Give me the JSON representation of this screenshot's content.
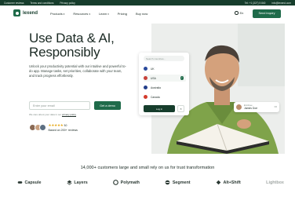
{
  "topbar": {
    "left_links": [
      "Customer reviews",
      "Terms and conditions",
      "Privacy policy"
    ],
    "phone": "Tel: +1 (327) 5 840",
    "email": "info@lexend.com"
  },
  "nav": {
    "logo_text": "lexend",
    "menu": [
      {
        "label": "Products",
        "has_dropdown": true
      },
      {
        "label": "Resources",
        "has_dropdown": true
      },
      {
        "label": "Learn",
        "has_dropdown": true
      },
      {
        "label": "Pricing",
        "has_dropdown": false
      },
      {
        "label": "Buy now",
        "has_dropdown": false
      }
    ],
    "language": "En",
    "cta_label": "Send inquiry"
  },
  "hero": {
    "title_line1": "Use Data & AI,",
    "title_line2": "Responsibly",
    "subtitle": "Unlock your productivity potential with our intuitive and powerful to-do app. Manage tasks, set priorities, collaborate with your team, and track progress effortlessly.",
    "email_placeholder": "Enter your email",
    "demo_button": "Get a demo",
    "privacy_text": "We care about your data in our",
    "privacy_link": "privacy policy",
    "rating_score": "5.0",
    "reviews": "Based on 200+ reviews"
  },
  "country_card": {
    "search_placeholder": "Search countries...",
    "options": [
      {
        "label": "UK",
        "flag_color": "#2a4a9c",
        "selected": false
      },
      {
        "label": "USA",
        "flag_color": "#c8423a",
        "selected": true
      },
      {
        "label": "Australia",
        "flag_color": "#233f8a",
        "selected": false
      },
      {
        "label": "Canada",
        "flag_color": "#d33a2c",
        "selected": false
      }
    ],
    "login_label": "Log in",
    "close_icon": "×"
  },
  "person_tag": {
    "role": "Employee",
    "name": "James Doe"
  },
  "trust": {
    "heading": "14,000+ customers large and small rely on us for trust transformation",
    "logos": [
      "Capsule",
      "Layers",
      "Polymath",
      "Segment",
      "Alt+Shift",
      "Lightbox"
    ]
  },
  "colors": {
    "brand_green": "#1f6b4a",
    "dark_green": "#163d2c",
    "star": "#e6a817"
  }
}
